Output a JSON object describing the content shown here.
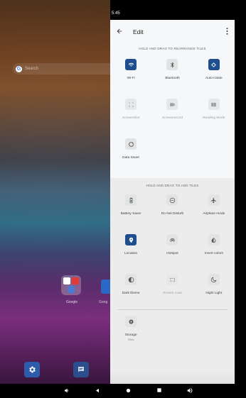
{
  "status": {
    "time": "5:45"
  },
  "home": {
    "search_placeholder": "Search",
    "folder_label": "Google",
    "app2_label": "Goog"
  },
  "header": {
    "title": "Edit"
  },
  "active_section": {
    "title": "HOLD AND DRAG TO REARRANGE TILES",
    "tiles": [
      {
        "label": "Wi-Fi",
        "icon": "wifi-icon",
        "on": true
      },
      {
        "label": "Bluetooth",
        "icon": "bluetooth-icon",
        "on": false
      },
      {
        "label": "Auto-rotate",
        "icon": "auto-rotate-icon",
        "on": true
      },
      {
        "label": "Screenshot",
        "icon": "screenshot-icon",
        "on": false,
        "dim": true
      },
      {
        "label": "Screenrecord",
        "icon": "screenrecord-icon",
        "on": false,
        "dim": true
      },
      {
        "label": "Reading Mode",
        "icon": "reading-mode-icon",
        "on": false,
        "dim": true
      },
      {
        "label": "Data Saver",
        "icon": "data-saver-icon",
        "on": false
      }
    ]
  },
  "add_section": {
    "title": "HOLD AND DRAG TO ADD TILES",
    "tiles": [
      {
        "label": "Battery Saver",
        "icon": "battery-saver-icon",
        "on": false
      },
      {
        "label": "Do Not Disturb",
        "icon": "do-not-disturb-icon",
        "on": false
      },
      {
        "label": "Airplane mode",
        "icon": "airplane-icon",
        "on": false
      },
      {
        "label": "Location",
        "icon": "location-icon",
        "on": true
      },
      {
        "label": "Hotspot",
        "icon": "hotspot-icon",
        "on": false
      },
      {
        "label": "Invert colors",
        "icon": "invert-colors-icon",
        "on": false
      },
      {
        "label": "Dark theme",
        "icon": "dark-theme-icon",
        "on": false
      },
      {
        "label": "Screen Cast",
        "icon": "screen-cast-icon",
        "on": false,
        "dim": true
      },
      {
        "label": "Night Light",
        "icon": "night-light-icon",
        "on": false
      }
    ],
    "extra_tile": {
      "label": "Storage",
      "sub": "Files",
      "icon": "storage-icon"
    }
  },
  "colors": {
    "active_tile": "#1f4e8f",
    "inactive_tile": "#e2e3e4",
    "panel_bg": "#f5f7f8"
  }
}
